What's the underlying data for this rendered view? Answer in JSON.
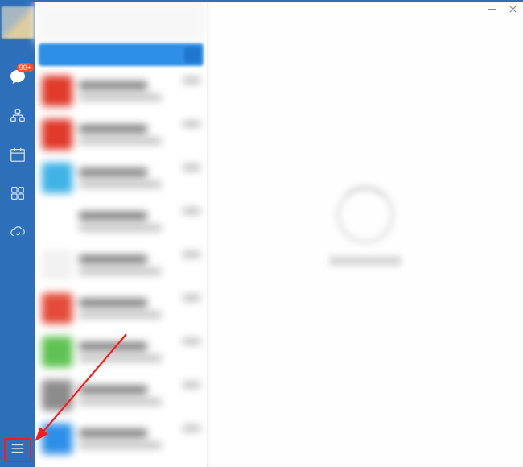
{
  "window": {
    "minimize_label": "Minimize",
    "close_label": "Close"
  },
  "sidebar": {
    "avatar_label": "User avatar",
    "items": [
      {
        "name": "chat",
        "badge": "99+"
      },
      {
        "name": "org"
      },
      {
        "name": "calendar"
      },
      {
        "name": "apps"
      },
      {
        "name": "cloud"
      }
    ],
    "menu_label": "Menu"
  },
  "conversation_list": {
    "selected_index": 0,
    "items": [
      {
        "avatar_color": "#e03a2a"
      },
      {
        "avatar_color": "#e03a2a"
      },
      {
        "avatar_color": "#3fb2e6"
      },
      {
        "avatar_color": "#ffffff"
      },
      {
        "avatar_color": "#f2f2f2"
      },
      {
        "avatar_color": "#e44c3a"
      },
      {
        "avatar_color": "#5fc253"
      },
      {
        "avatar_color": "#8c8c8c"
      },
      {
        "avatar_color": "#2d8fe8"
      }
    ]
  },
  "main": {
    "loading": true
  },
  "annotation": {
    "highlight_target": "menu-button",
    "arrow_color": "#ff1a1a"
  }
}
